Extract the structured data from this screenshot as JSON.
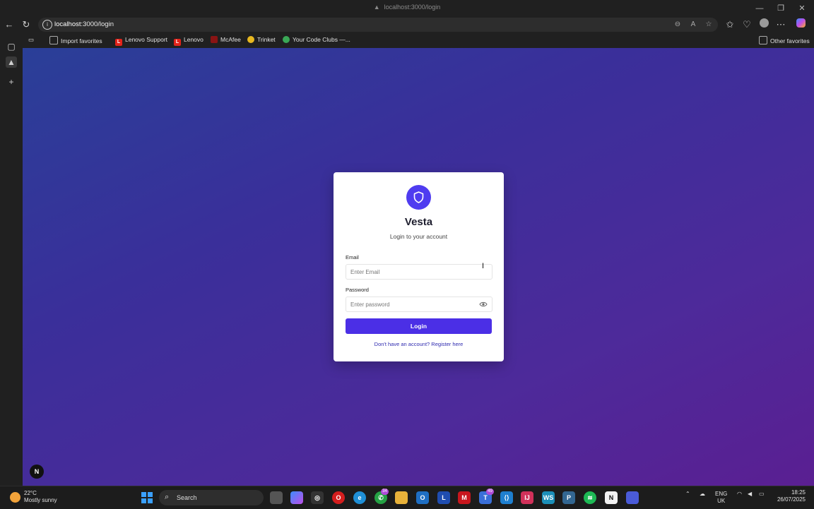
{
  "browser": {
    "title": "localhost:3000/login",
    "url_host": "localhost",
    "url_path": ":3000/login",
    "window_controls": [
      "minimize-icon",
      "restore-icon",
      "close-icon"
    ]
  },
  "bookmarks": [
    {
      "label": "Import favorites",
      "icon": "import-icon",
      "color": "#5a5a5a"
    },
    {
      "label": "Lenovo Support",
      "icon": "L",
      "color": "#e2231a"
    },
    {
      "label": "Lenovo",
      "icon": "L",
      "color": "#e2231a"
    },
    {
      "label": "McAfee",
      "icon": "M",
      "color": "#c01818"
    },
    {
      "label": "Trinket",
      "icon": "T",
      "color": "#e8b820"
    },
    {
      "label": "Your Code Clubs —...",
      "icon": "C",
      "color": "#3aa856"
    }
  ],
  "other_favorites": "Other favorites",
  "login": {
    "app_name": "Vesta",
    "subtitle": "Login to your account",
    "email_label": "Email",
    "email_placeholder": "Enter Email",
    "password_label": "Password",
    "password_placeholder": "Enter password",
    "login_button": "Login",
    "register_link": "Don't have an account? Register here",
    "accent_color": "#4b2fe6"
  },
  "next_badge": "N",
  "taskbar": {
    "weather_temp": "22°C",
    "weather_desc": "Mostly sunny",
    "search_label": "Search",
    "badge_whatsapp": "34",
    "badge_teams": "49",
    "lang_line1": "ENG",
    "lang_line2": "UK",
    "time": "18:25",
    "date": "26/07/2025"
  }
}
